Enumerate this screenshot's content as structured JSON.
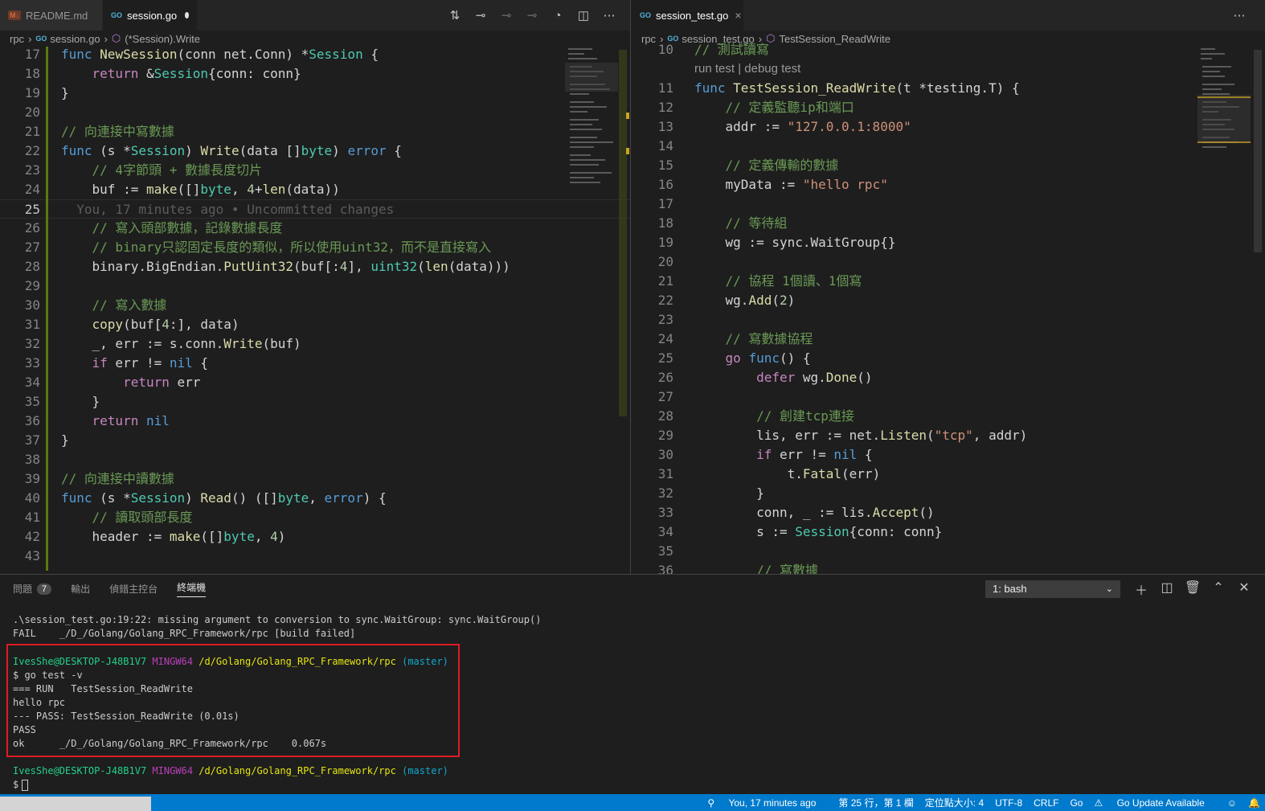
{
  "left_editor": {
    "tabs": [
      {
        "icon": "md-icon",
        "label": "README.md"
      },
      {
        "icon": "go-icon",
        "label": "session.go",
        "modified": true
      }
    ],
    "breadcrumb": [
      "rpc",
      "session.go",
      "(*Session).Write"
    ],
    "blame": "You, 17 minutes ago • Uncommitted changes",
    "lines": [
      {
        "n": "17",
        "t": "func NewSession(conn net.Conn) *Session {"
      },
      {
        "n": "18",
        "t": "    return &Session{conn: conn}"
      },
      {
        "n": "19",
        "t": "}"
      },
      {
        "n": "20",
        "t": ""
      },
      {
        "n": "21",
        "t": "// 向連接中寫數據"
      },
      {
        "n": "22",
        "t": "func (s *Session) Write(data []byte) error {"
      },
      {
        "n": "23",
        "t": "    // 4字節頭 + 數據長度切片"
      },
      {
        "n": "24",
        "t": "    buf := make([]byte, 4+len(data))"
      },
      {
        "n": "25",
        "t": ""
      },
      {
        "n": "26",
        "t": "    // 寫入頭部數據，記錄數據長度"
      },
      {
        "n": "27",
        "t": "    // binary只認固定長度的類似，所以使用uint32，而不是直接寫入"
      },
      {
        "n": "28",
        "t": "    binary.BigEndian.PutUint32(buf[:4], uint32(len(data)))"
      },
      {
        "n": "29",
        "t": ""
      },
      {
        "n": "30",
        "t": "    // 寫入數據"
      },
      {
        "n": "31",
        "t": "    copy(buf[4:], data)"
      },
      {
        "n": "32",
        "t": "    _, err := s.conn.Write(buf)"
      },
      {
        "n": "33",
        "t": "    if err != nil {"
      },
      {
        "n": "34",
        "t": "        return err"
      },
      {
        "n": "35",
        "t": "    }"
      },
      {
        "n": "36",
        "t": "    return nil"
      },
      {
        "n": "37",
        "t": "}"
      },
      {
        "n": "38",
        "t": ""
      },
      {
        "n": "39",
        "t": "// 向連接中讀數據"
      },
      {
        "n": "40",
        "t": "func (s *Session) Read() ([]byte, error) {"
      },
      {
        "n": "41",
        "t": "    // 讀取頭部長度"
      },
      {
        "n": "42",
        "t": "    header := make([]byte, 4)"
      },
      {
        "n": "43",
        "t": ""
      }
    ]
  },
  "right_editor": {
    "tabs": [
      {
        "icon": "go-icon",
        "label": "session_test.go"
      }
    ],
    "breadcrumb": [
      "rpc",
      "session_test.go",
      "TestSession_ReadWrite"
    ],
    "codelens": "run test | debug test",
    "lines": [
      {
        "n": "10",
        "t": "// 測試讀寫"
      },
      {
        "n": "11",
        "t": "func TestSession_ReadWrite(t *testing.T) {"
      },
      {
        "n": "12",
        "t": "    // 定義監聽ip和端口"
      },
      {
        "n": "13",
        "t": "    addr := \"127.0.0.1:8000\""
      },
      {
        "n": "14",
        "t": ""
      },
      {
        "n": "15",
        "t": "    // 定義傳輸的數據"
      },
      {
        "n": "16",
        "t": "    myData := \"hello rpc\""
      },
      {
        "n": "17",
        "t": ""
      },
      {
        "n": "18",
        "t": "    // 等待組"
      },
      {
        "n": "19",
        "t": "    wg := sync.WaitGroup{}"
      },
      {
        "n": "20",
        "t": ""
      },
      {
        "n": "21",
        "t": "    // 協程 1個讀、1個寫"
      },
      {
        "n": "22",
        "t": "    wg.Add(2)"
      },
      {
        "n": "23",
        "t": ""
      },
      {
        "n": "24",
        "t": "    // 寫數據協程"
      },
      {
        "n": "25",
        "t": "    go func() {"
      },
      {
        "n": "26",
        "t": "        defer wg.Done()"
      },
      {
        "n": "27",
        "t": ""
      },
      {
        "n": "28",
        "t": "        // 創建tcp連接"
      },
      {
        "n": "29",
        "t": "        lis, err := net.Listen(\"tcp\", addr)"
      },
      {
        "n": "30",
        "t": "        if err != nil {"
      },
      {
        "n": "31",
        "t": "            t.Fatal(err)"
      },
      {
        "n": "32",
        "t": "        }"
      },
      {
        "n": "33",
        "t": "        conn, _ := lis.Accept()"
      },
      {
        "n": "34",
        "t": "        s := Session{conn: conn}"
      },
      {
        "n": "35",
        "t": ""
      },
      {
        "n": "36",
        "t": "        // 寫數據"
      }
    ]
  },
  "panel": {
    "tabs": {
      "problems": "問題",
      "problems_count": "7",
      "output": "輸出",
      "debug_console": "偵錯主控台",
      "terminal": "終端機"
    },
    "shell": "1: bash",
    "terminal": {
      "err1": ".\\session_test.go:19:22: missing argument to conversion to sync.WaitGroup: sync.WaitGroup()",
      "err2": "FAIL    _/D_/Golang/Golang_RPC_Framework/rpc [build failed]",
      "user": "IvesShe@DESKTOP-J48B1V7",
      "host": "MINGW64",
      "path": "/d/Golang/Golang_RPC_Framework/rpc",
      "branch": "(master)",
      "cmd": "$ go test -v",
      "run": "=== RUN   TestSession_ReadWrite",
      "out": "hello rpc",
      "pass_line": "--- PASS: TestSession_ReadWrite (0.01s)",
      "pass": "PASS",
      "ok": "ok      _/D_/Golang/Golang_RPC_Framework/rpc    0.067s",
      "prompt": "$"
    }
  },
  "statusbar": {
    "blame": "You, 17 minutes ago",
    "position": "第 25 行，第 1 欄",
    "tab_size": "定位點大小: 4",
    "encoding": "UTF-8",
    "eol": "CRLF",
    "language": "Go",
    "update": "Go Update Available"
  }
}
